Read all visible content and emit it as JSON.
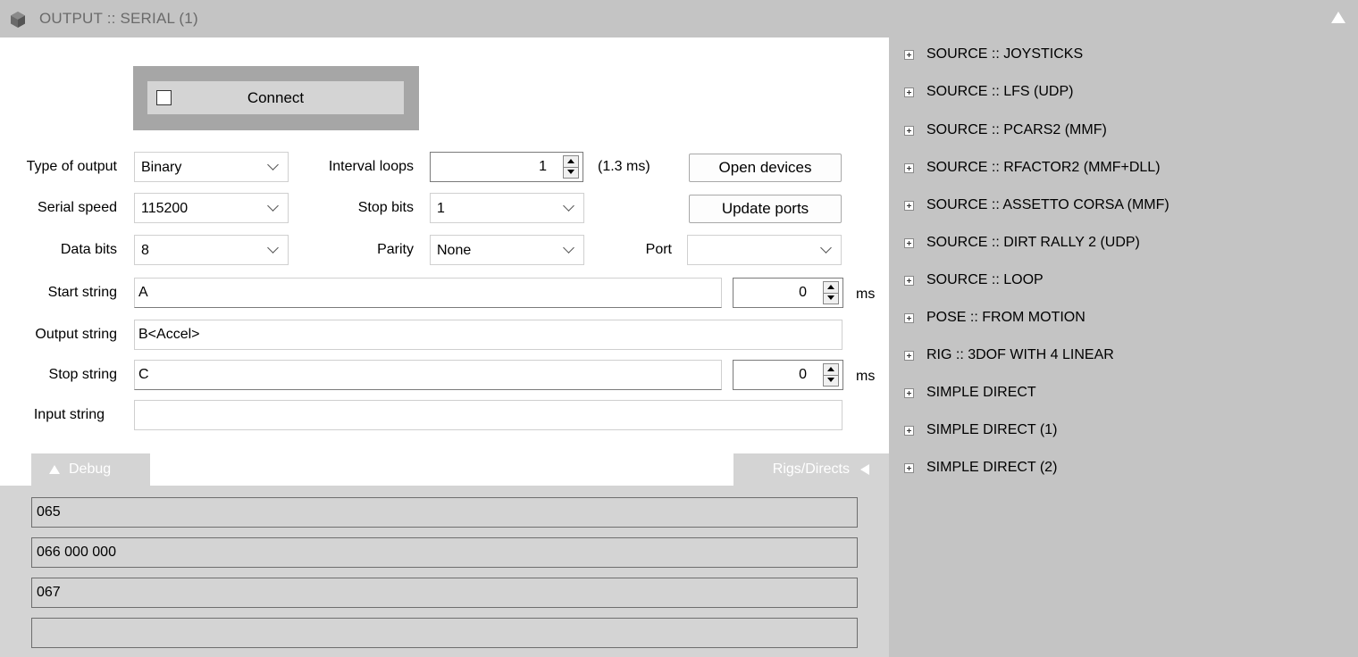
{
  "window": {
    "title": "OUTPUT :: SERIAL (1)"
  },
  "connect": {
    "label": "Connect",
    "checked": false
  },
  "form": {
    "type_of_output": {
      "label": "Type of output",
      "value": "Binary"
    },
    "serial_speed": {
      "label": "Serial speed",
      "value": "115200"
    },
    "data_bits": {
      "label": "Data bits",
      "value": "8"
    },
    "interval_loops": {
      "label": "Interval loops",
      "value": "1",
      "note": "(1.3 ms)"
    },
    "stop_bits": {
      "label": "Stop bits",
      "value": "1"
    },
    "parity": {
      "label": "Parity",
      "value": "None"
    },
    "port": {
      "label": "Port",
      "value": ""
    },
    "start_string": {
      "label": "Start string",
      "value": "A",
      "delay": "0",
      "unit": "ms"
    },
    "output_string": {
      "label": "Output string",
      "value": "B<Accel>"
    },
    "stop_string": {
      "label": "Stop string",
      "value": "C",
      "delay": "0",
      "unit": "ms"
    },
    "input_string": {
      "label": "Input string",
      "value": ""
    }
  },
  "buttons": {
    "open_devices": "Open devices",
    "update_ports": "Update ports"
  },
  "tabs": {
    "debug": "Debug",
    "rigs_directs": "Rigs/Directs"
  },
  "debug_lines": [
    "065",
    "066 000 000",
    "067",
    ""
  ],
  "tree": [
    "SOURCE :: JOYSTICKS",
    "SOURCE :: LFS (UDP)",
    "SOURCE :: PCARS2 (MMF)",
    "SOURCE :: RFACTOR2 (MMF+DLL)",
    "SOURCE :: ASSETTO CORSA (MMF)",
    "SOURCE :: DIRT RALLY 2 (UDP)",
    "SOURCE :: LOOP",
    "POSE :: FROM MOTION",
    "RIG :: 3DOF WITH 4 LINEAR",
    "SIMPLE DIRECT",
    "SIMPLE DIRECT (1)",
    "SIMPLE DIRECT (2)"
  ],
  "icons": {
    "title": "cube-icon",
    "collapse": "triangle-up-icon",
    "dropdown": "chevron-down-icon",
    "spinner": "spinner-arrows-icon",
    "tree_expand": "plus-box-icon"
  }
}
